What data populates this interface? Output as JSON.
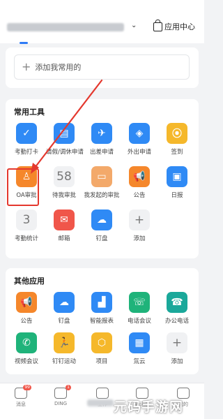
{
  "header": {
    "app_center_label": "应用中心",
    "caret": "⌄"
  },
  "favorites": {
    "add_label": "添加我常用的",
    "add_symbol": "+"
  },
  "common_tools": {
    "title": "常用工具",
    "items": [
      {
        "label": "考勤打卡",
        "color": "#2f8af5",
        "icon": "location-check-icon",
        "glyph": "✓"
      },
      {
        "label": "请假/调休申请",
        "color": "#2f8af5",
        "icon": "calendar-leave-icon",
        "glyph": "▤"
      },
      {
        "label": "出差申请",
        "color": "#2f8af5",
        "icon": "airplane-icon",
        "glyph": "✈"
      },
      {
        "label": "外出申请",
        "color": "#2f8af5",
        "icon": "outing-icon",
        "glyph": "◈"
      },
      {
        "label": "签到",
        "color": "#f5b82b",
        "icon": "checkin-pin-icon",
        "glyph": "⦿"
      },
      {
        "label": "OA审批",
        "color": "#f5872b",
        "icon": "stamp-icon",
        "glyph": "♙"
      },
      {
        "label": "待我审批",
        "color": "",
        "icon": "count-icon",
        "glyph": "58"
      },
      {
        "label": "我发起的审批",
        "color": "#f3a96a",
        "icon": "document-icon",
        "glyph": "▭"
      },
      {
        "label": "公告",
        "color": "#f5872b",
        "icon": "megaphone-icon",
        "glyph": "📢"
      },
      {
        "label": "日报",
        "color": "#2f8af5",
        "icon": "daily-report-icon",
        "glyph": "▣"
      },
      {
        "label": "考勤统计",
        "color": "",
        "icon": "count-icon",
        "glyph": "3"
      },
      {
        "label": "邮箱",
        "color": "#f0564a",
        "icon": "mail-icon",
        "glyph": "✉"
      },
      {
        "label": "钉盘",
        "color": "#2f8af5",
        "icon": "cloud-disk-icon",
        "glyph": "☁"
      },
      {
        "label": "添加",
        "color": "",
        "icon": "add-icon",
        "glyph": "+"
      }
    ]
  },
  "other_apps": {
    "title": "其他应用",
    "items": [
      {
        "label": "公告",
        "color": "#f5872b",
        "icon": "megaphone-icon",
        "glyph": "📢"
      },
      {
        "label": "钉盘",
        "color": "#2f8af5",
        "icon": "cloud-disk-icon",
        "glyph": "☁"
      },
      {
        "label": "智能报表",
        "color": "#2f8af5",
        "icon": "bar-chart-icon",
        "glyph": "▟"
      },
      {
        "label": "电话会议",
        "color": "#1fb37a",
        "icon": "conference-call-icon",
        "glyph": "☏"
      },
      {
        "label": "办公电话",
        "color": "#1aa89a",
        "icon": "office-phone-icon",
        "glyph": "☎"
      },
      {
        "label": "视频会议",
        "color": "#1fb37a",
        "icon": "video-call-icon",
        "glyph": "✆"
      },
      {
        "label": "钉钉运动",
        "color": "#f5b82b",
        "icon": "running-icon",
        "glyph": "🏃"
      },
      {
        "label": "项目",
        "color": "#f5b82b",
        "icon": "project-hexagon-icon",
        "glyph": "⬡"
      },
      {
        "label": "氚云",
        "color": "#2f8af5",
        "icon": "tritium-cloud-icon",
        "glyph": "▦"
      },
      {
        "label": "添加",
        "color": "",
        "icon": "add-icon",
        "glyph": "+"
      }
    ]
  },
  "tabs": [
    {
      "label": "消息",
      "icon": "message-icon",
      "badge": "99"
    },
    {
      "label": "DING",
      "icon": "ding-icon",
      "badge": "1"
    },
    {
      "label": "工作",
      "icon": "work-icon",
      "badge": ""
    },
    {
      "label": "通讯录",
      "icon": "contacts-icon",
      "badge": ""
    },
    {
      "label": "我的",
      "icon": "profile-icon",
      "badge": ""
    }
  ],
  "watermark": "元码手游网",
  "accent": "#2f7cf6",
  "highlight_color": "#e4382e"
}
